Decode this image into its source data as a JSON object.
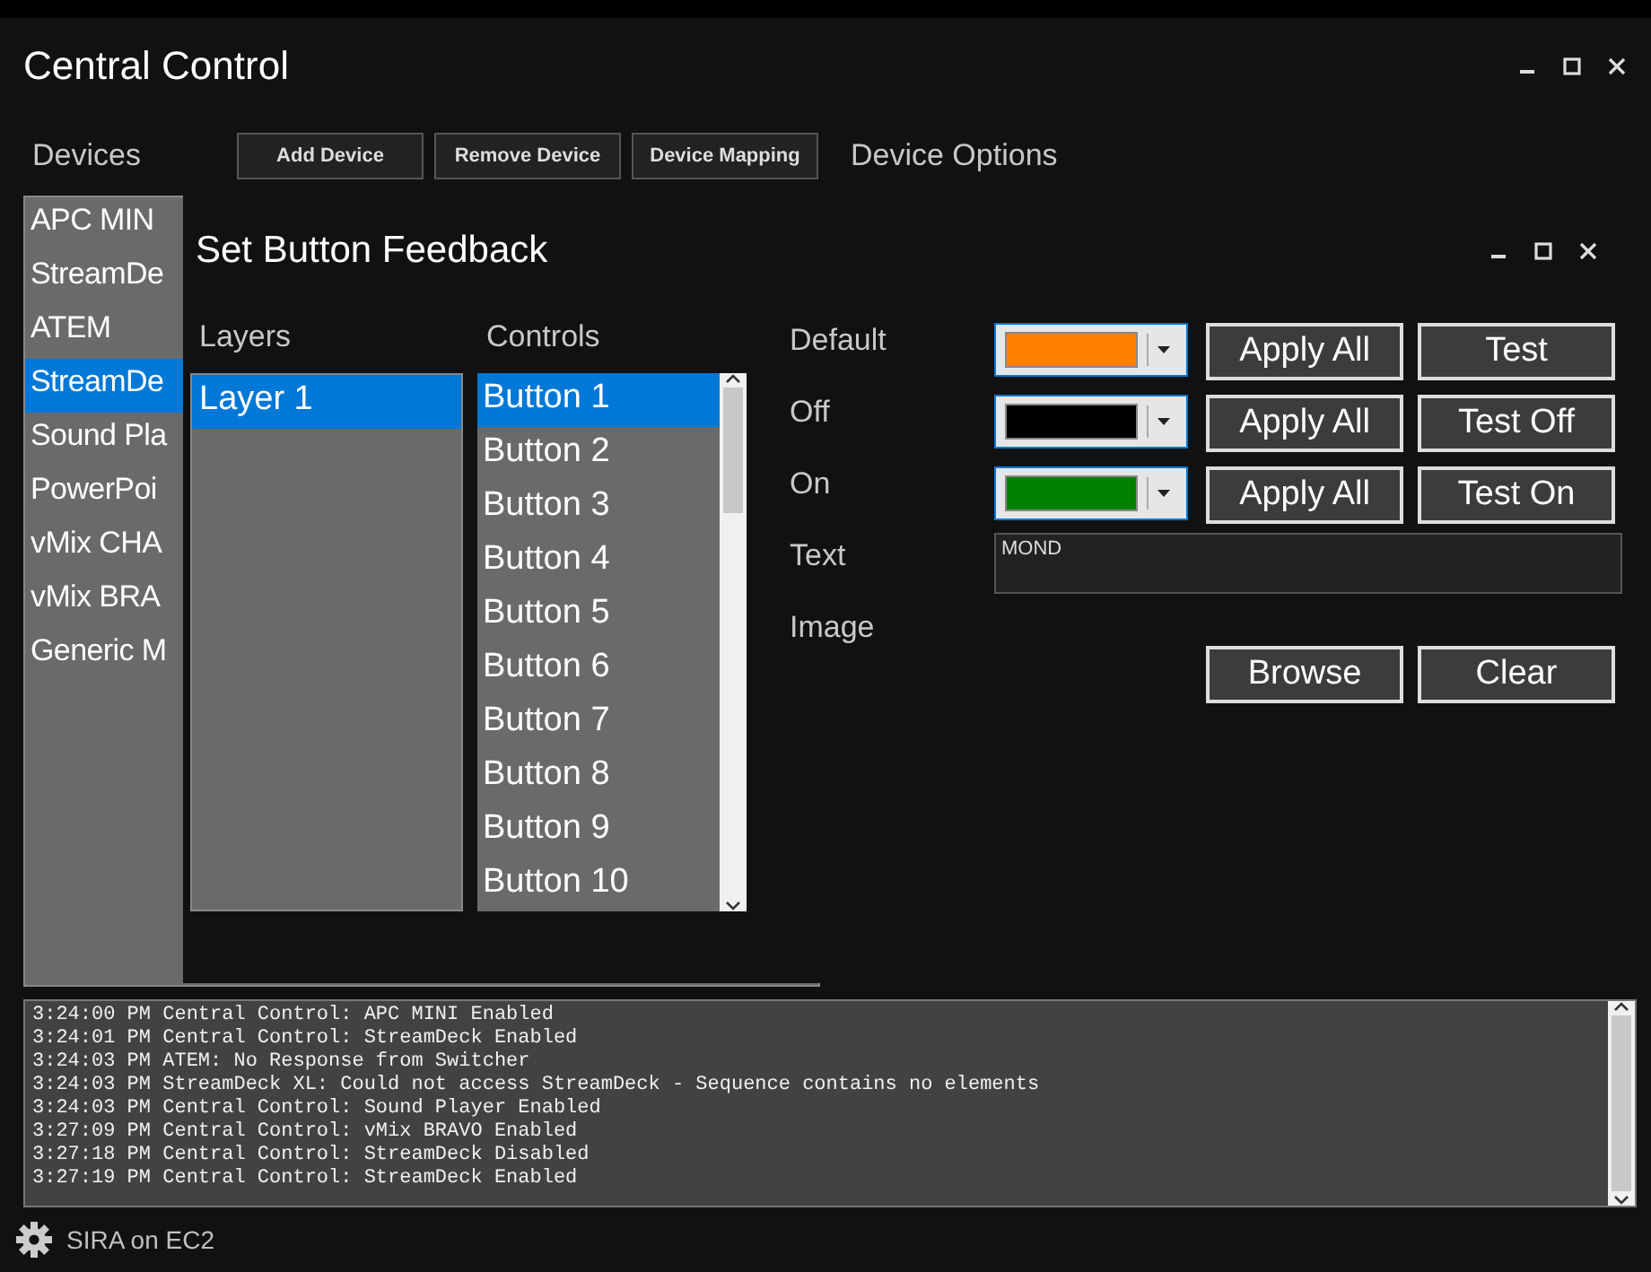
{
  "window": {
    "title": "Central Control"
  },
  "devices_label": "Devices",
  "toolbar_buttons": [
    "Add Device",
    "Remove Device",
    "Device Mapping"
  ],
  "device_options_label": "Device Options",
  "devices": [
    {
      "label": "APC MIN",
      "selected": false
    },
    {
      "label": "StreamDe",
      "selected": false
    },
    {
      "label": "ATEM",
      "selected": false
    },
    {
      "label": "StreamDe",
      "selected": true
    },
    {
      "label": "Sound Pla",
      "selected": false
    },
    {
      "label": "PowerPoi",
      "selected": false
    },
    {
      "label": "vMix CHA",
      "selected": false
    },
    {
      "label": "vMix BRA",
      "selected": false
    },
    {
      "label": "Generic M",
      "selected": false
    }
  ],
  "log": [
    "3:24:00 PM Central Control: APC MINI Enabled",
    "3:24:01 PM Central Control: StreamDeck Enabled",
    "3:24:03 PM ATEM: No Response from Switcher",
    "3:24:03 PM StreamDeck XL: Could not access StreamDeck - Sequence contains no elements",
    "3:24:03 PM Central Control: Sound Player Enabled",
    "3:27:09 PM Central Control: vMix BRAVO Enabled",
    "3:27:18 PM Central Control: StreamDeck Disabled",
    "3:27:19 PM Central Control: StreamDeck Enabled"
  ],
  "status_bar": {
    "text": "SIRA on EC2"
  },
  "dialog": {
    "title": "Set Button Feedback",
    "layers_label": "Layers",
    "controls_label": "Controls",
    "layers": [
      {
        "label": "Layer 1",
        "selected": true
      }
    ],
    "controls": [
      {
        "label": "Button 1",
        "selected": true
      },
      {
        "label": "Button 2",
        "selected": false
      },
      {
        "label": "Button 3",
        "selected": false
      },
      {
        "label": "Button 4",
        "selected": false
      },
      {
        "label": "Button 5",
        "selected": false
      },
      {
        "label": "Button 6",
        "selected": false
      },
      {
        "label": "Button 7",
        "selected": false
      },
      {
        "label": "Button 8",
        "selected": false
      },
      {
        "label": "Button 9",
        "selected": false
      },
      {
        "label": "Button 10",
        "selected": false
      }
    ],
    "feedback_rows": [
      {
        "label": "Default",
        "color": "#ff8000",
        "apply": "Apply All",
        "test": "Test"
      },
      {
        "label": "Off",
        "color": "#000000",
        "apply": "Apply All",
        "test": "Test Off"
      },
      {
        "label": "On",
        "color": "#008000",
        "apply": "Apply All",
        "test": "Test On"
      }
    ],
    "text_label": "Text",
    "text_value": "MOND",
    "image_label": "Image",
    "image_buttons": [
      "Browse",
      "Clear"
    ]
  }
}
